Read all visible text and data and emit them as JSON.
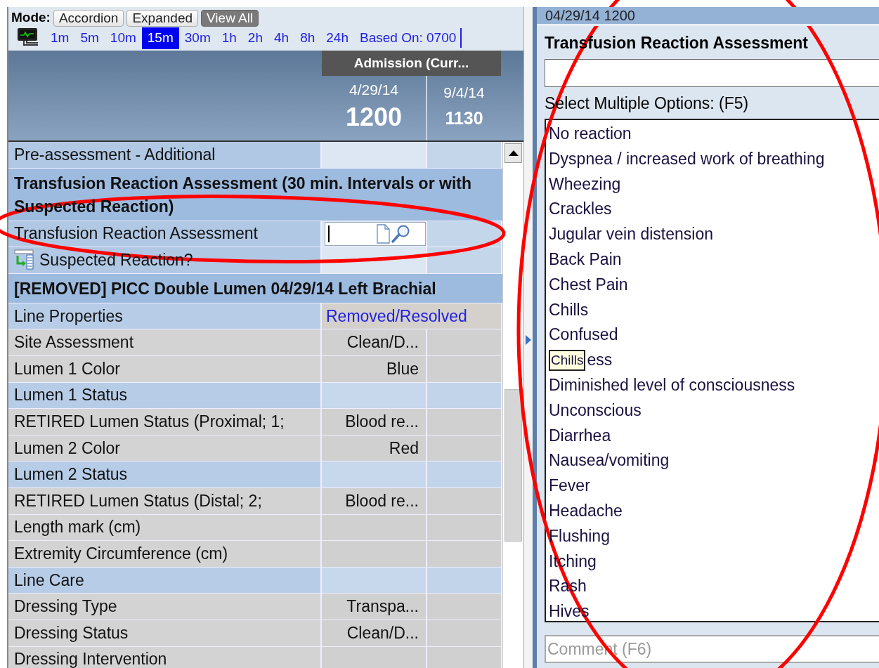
{
  "mode_bar": {
    "label": "Mode:",
    "buttons": [
      {
        "label": "Accordion",
        "selected": false
      },
      {
        "label": "Expanded",
        "selected": false
      },
      {
        "label": "View All",
        "selected": true
      }
    ]
  },
  "intervals": {
    "items": [
      {
        "label": "1m",
        "selected": false
      },
      {
        "label": "5m",
        "selected": false
      },
      {
        "label": "10m",
        "selected": false
      },
      {
        "label": "15m",
        "selected": true
      },
      {
        "label": "30m",
        "selected": false
      },
      {
        "label": "1h",
        "selected": false
      },
      {
        "label": "2h",
        "selected": false
      },
      {
        "label": "4h",
        "selected": false
      },
      {
        "label": "8h",
        "selected": false
      },
      {
        "label": "24h",
        "selected": false
      }
    ],
    "based_on": "Based On: 0700"
  },
  "grid_header": {
    "encounter": "Admission (Curr...",
    "columns": [
      {
        "date": "4/29/14",
        "time": "1200"
      },
      {
        "date": "9/4/14",
        "time": "1130"
      }
    ]
  },
  "rows": [
    {
      "kind": "section",
      "label": "Pre-assessment - Additional"
    },
    {
      "kind": "header",
      "label": "Transfusion Reaction Assessment (30 min. Intervals or with Suspected Reaction)"
    },
    {
      "kind": "input",
      "label": "Transfusion Reaction Assessment"
    },
    {
      "kind": "linked",
      "label": "Suspected Reaction?"
    },
    {
      "kind": "header",
      "label": "[REMOVED] PICC Double Lumen 04/29/14 Left Brachial"
    },
    {
      "kind": "link",
      "label": "Line Properties",
      "value": "Removed/Resolved"
    },
    {
      "kind": "item",
      "label": "Site Assessment",
      "value": "Clean/D..."
    },
    {
      "kind": "item",
      "label": "Lumen 1 Color",
      "value": "Blue"
    },
    {
      "kind": "group",
      "label": "Lumen 1 Status"
    },
    {
      "kind": "item",
      "label": "RETIRED Lumen Status (Proximal; 1;",
      "value": "Blood re..."
    },
    {
      "kind": "item",
      "label": "Lumen 2 Color",
      "value": "Red"
    },
    {
      "kind": "group",
      "label": "Lumen 2 Status"
    },
    {
      "kind": "item",
      "label": "RETIRED Lumen Status (Distal; 2;",
      "value": "Blood re..."
    },
    {
      "kind": "item",
      "label": "Length mark (cm)"
    },
    {
      "kind": "item",
      "label": "Extremity Circumference (cm)"
    },
    {
      "kind": "group",
      "label": "Line Care"
    },
    {
      "kind": "item",
      "label": "Dressing Type",
      "value": "Transpa..."
    },
    {
      "kind": "item",
      "label": "Dressing Status",
      "value": "Clean/D..."
    },
    {
      "kind": "item",
      "label": "Dressing Intervention"
    }
  ],
  "detail_panel": {
    "timestamp": "04/29/14 1200",
    "title": "Transfusion Reaction Assessment",
    "prompt": "Select Multiple Options: (F5)",
    "options": [
      {
        "label": "No reaction"
      },
      {
        "label": "Dyspnea / increased work of breathing"
      },
      {
        "label": "Wheezing"
      },
      {
        "label": "Crackles"
      },
      {
        "label": "Jugular vein distension"
      },
      {
        "label": "Back Pain"
      },
      {
        "label": "Chest Pain"
      },
      {
        "label": "Chills"
      },
      {
        "label": "Confused"
      },
      {
        "label": "ess",
        "tooltip": "Chills"
      },
      {
        "label": "Diminished level of consciousness"
      },
      {
        "label": "Unconscious"
      },
      {
        "label": "Diarrhea"
      },
      {
        "label": "Nausea/vomiting"
      },
      {
        "label": "Fever"
      },
      {
        "label": "Headache"
      },
      {
        "label": "Flushing"
      },
      {
        "label": "Itching"
      },
      {
        "label": "Rash"
      },
      {
        "label": "Hives"
      }
    ],
    "comment": {
      "placeholder": "Comment (F6)"
    }
  },
  "annotations": [
    {
      "kind": "ellipse"
    },
    {
      "kind": "ellipse"
    }
  ]
}
